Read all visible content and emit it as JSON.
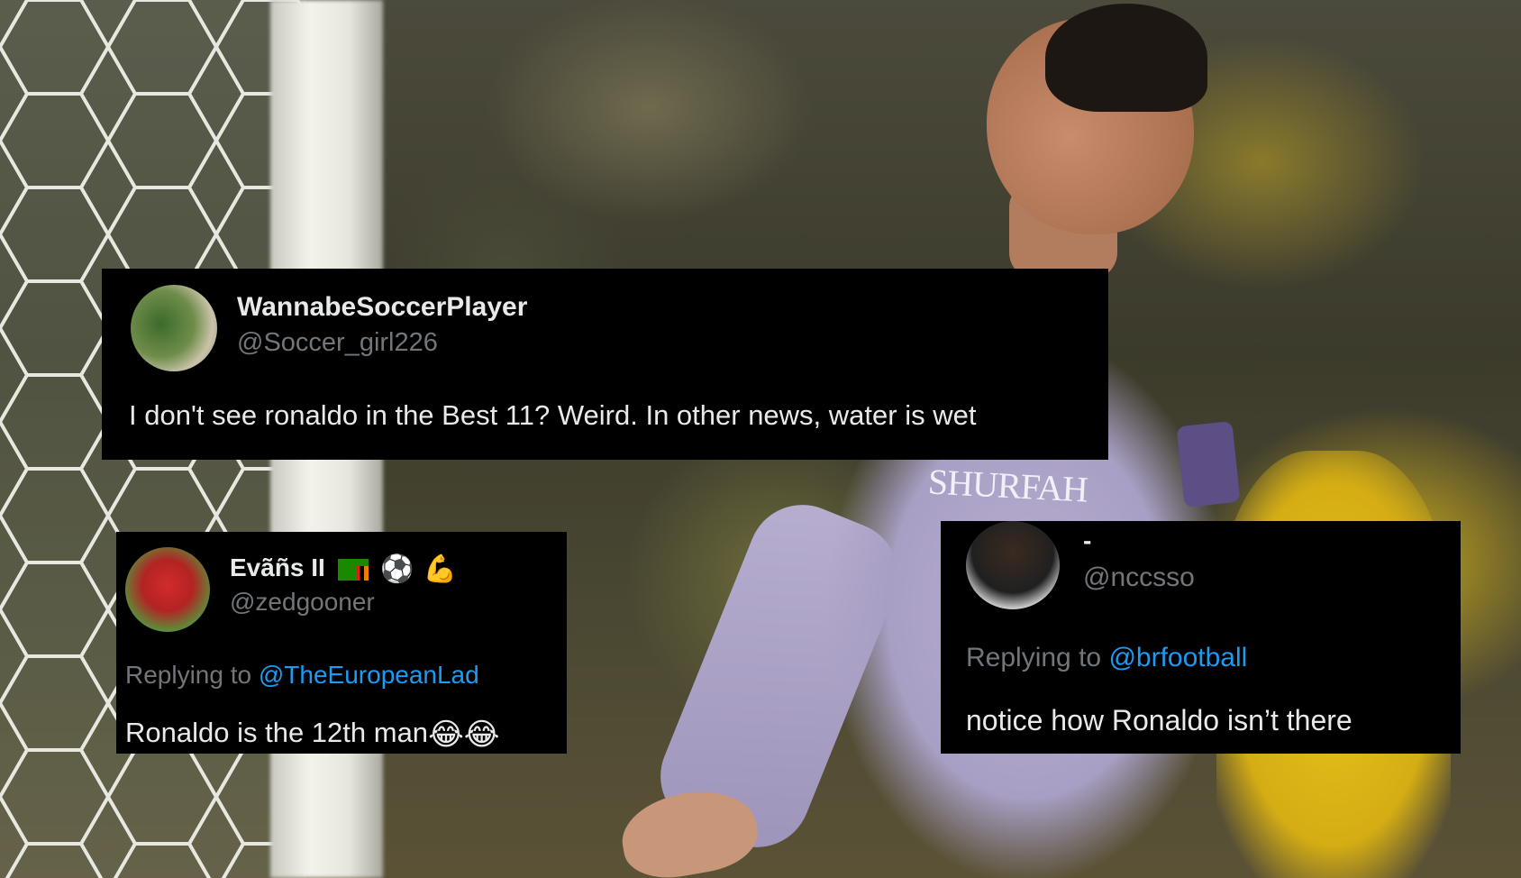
{
  "tweets": [
    {
      "display_name": "WannabeSoccerPlayer",
      "handle": "@Soccer_girl226",
      "text": "I don't see ronaldo in the Best 11? Weird. In other news, water is wet"
    },
    {
      "display_name": "Evãñs II",
      "name_emojis": [
        "flag-zambia-icon",
        "soccer-ball-icon",
        "flexed-biceps-icon"
      ],
      "handle": "@zedgooner",
      "reply_prefix": "Replying to",
      "reply_mention": "@TheEuropeanLad",
      "text": "Ronaldo is the 12th man",
      "text_emojis": [
        "tears-of-joy-icon",
        "tears-of-joy-icon"
      ]
    },
    {
      "display_name": "-",
      "handle": "@nccsso",
      "reply_prefix": "Replying to",
      "reply_mention": "@brfootball",
      "text": "notice how Ronaldo isn’t there"
    }
  ],
  "background": {
    "shirt_text": "SHURFAH"
  },
  "colors": {
    "card_bg": "#000000",
    "name": "#e7e9ea",
    "handle": "#71767b",
    "mention": "#1d9bf0"
  }
}
